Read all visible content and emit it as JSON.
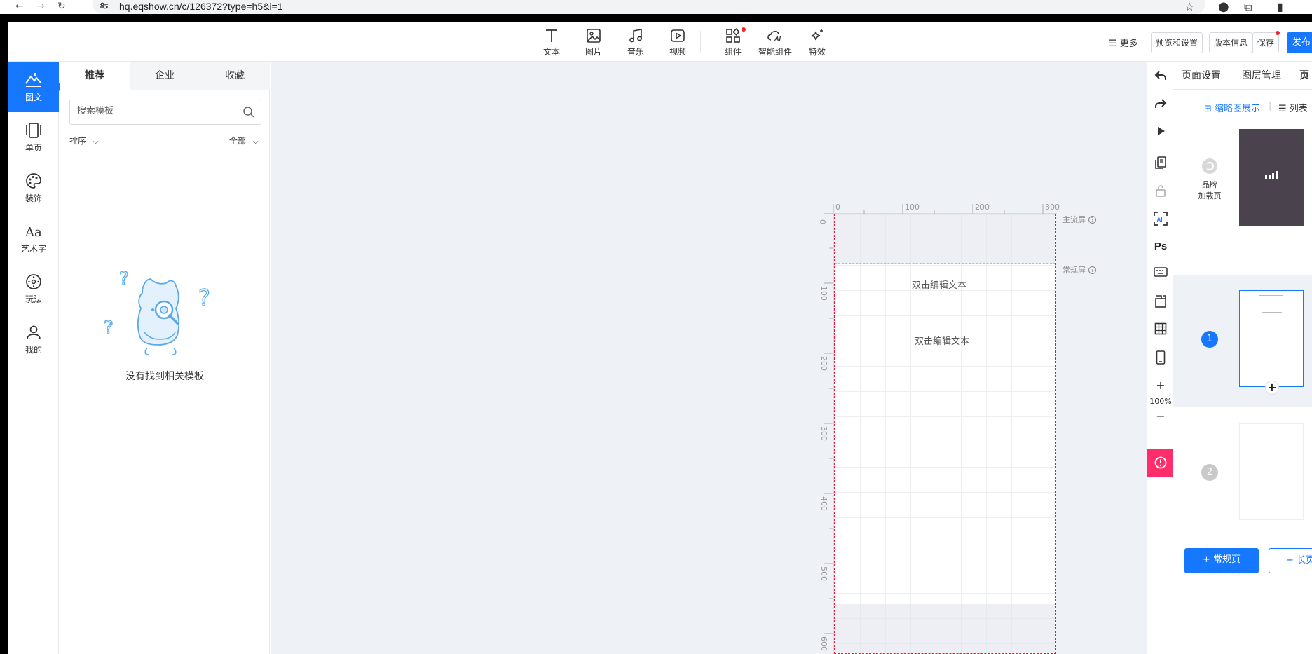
{
  "browser": {
    "url": "hq.eqshow.cn/c/126372?type=h5&i=1"
  },
  "toolbar": {
    "tools": [
      {
        "name": "text",
        "label": "文本"
      },
      {
        "name": "image",
        "label": "图片"
      },
      {
        "name": "music",
        "label": "音乐"
      },
      {
        "name": "video",
        "label": "视频"
      },
      {
        "name": "component",
        "label": "组件"
      },
      {
        "name": "ai-component",
        "label": "智能组件"
      },
      {
        "name": "effects",
        "label": "特效"
      }
    ],
    "more_label": "更多",
    "preview_label": "预览和设置",
    "version_label": "版本信息",
    "save_label": "保存",
    "publish_label": "发布"
  },
  "leftnav": {
    "items": [
      {
        "label": "图文",
        "active": true
      },
      {
        "label": "单页"
      },
      {
        "label": "装饰"
      },
      {
        "label": "艺术字"
      },
      {
        "label": "玩法"
      },
      {
        "label": "我的"
      }
    ]
  },
  "templates": {
    "tabs": [
      "推荐",
      "企业",
      "收藏"
    ],
    "search_placeholder": "搜索模板",
    "sort_label": "排序",
    "filter_label": "全部",
    "empty_text": "没有找到相关模板"
  },
  "canvas": {
    "ruler_h": [
      "0",
      "100",
      "200",
      "300"
    ],
    "ruler_v": [
      "0",
      "100",
      "200",
      "300",
      "400",
      "500",
      "600"
    ],
    "text_1": "双击编辑文本",
    "text_2": "双击编辑文本",
    "main_screen_label": "主流屏",
    "normal_screen_label": "常规屏"
  },
  "vtoolbar": {
    "ps_label": "Ps",
    "ai_label": "AI",
    "zoom": "100%",
    "plus": "+",
    "minus": "−"
  },
  "pages": {
    "tabs": [
      "页面设置",
      "图层管理",
      "页"
    ],
    "thumb_view_label": "缩略图展示",
    "list_view_label": "列表",
    "brand_page_label_1": "品牌",
    "brand_page_label_2": "加载页",
    "page_numbers": [
      "1",
      "2"
    ],
    "add_normal_label": "+ 常规页",
    "add_long_label": "+ 长页"
  },
  "colors": {
    "primary": "#1677ff",
    "alert": "#ff2e6a",
    "canvas_bg": "#eef1f6",
    "safe_border": "#e0193a"
  }
}
